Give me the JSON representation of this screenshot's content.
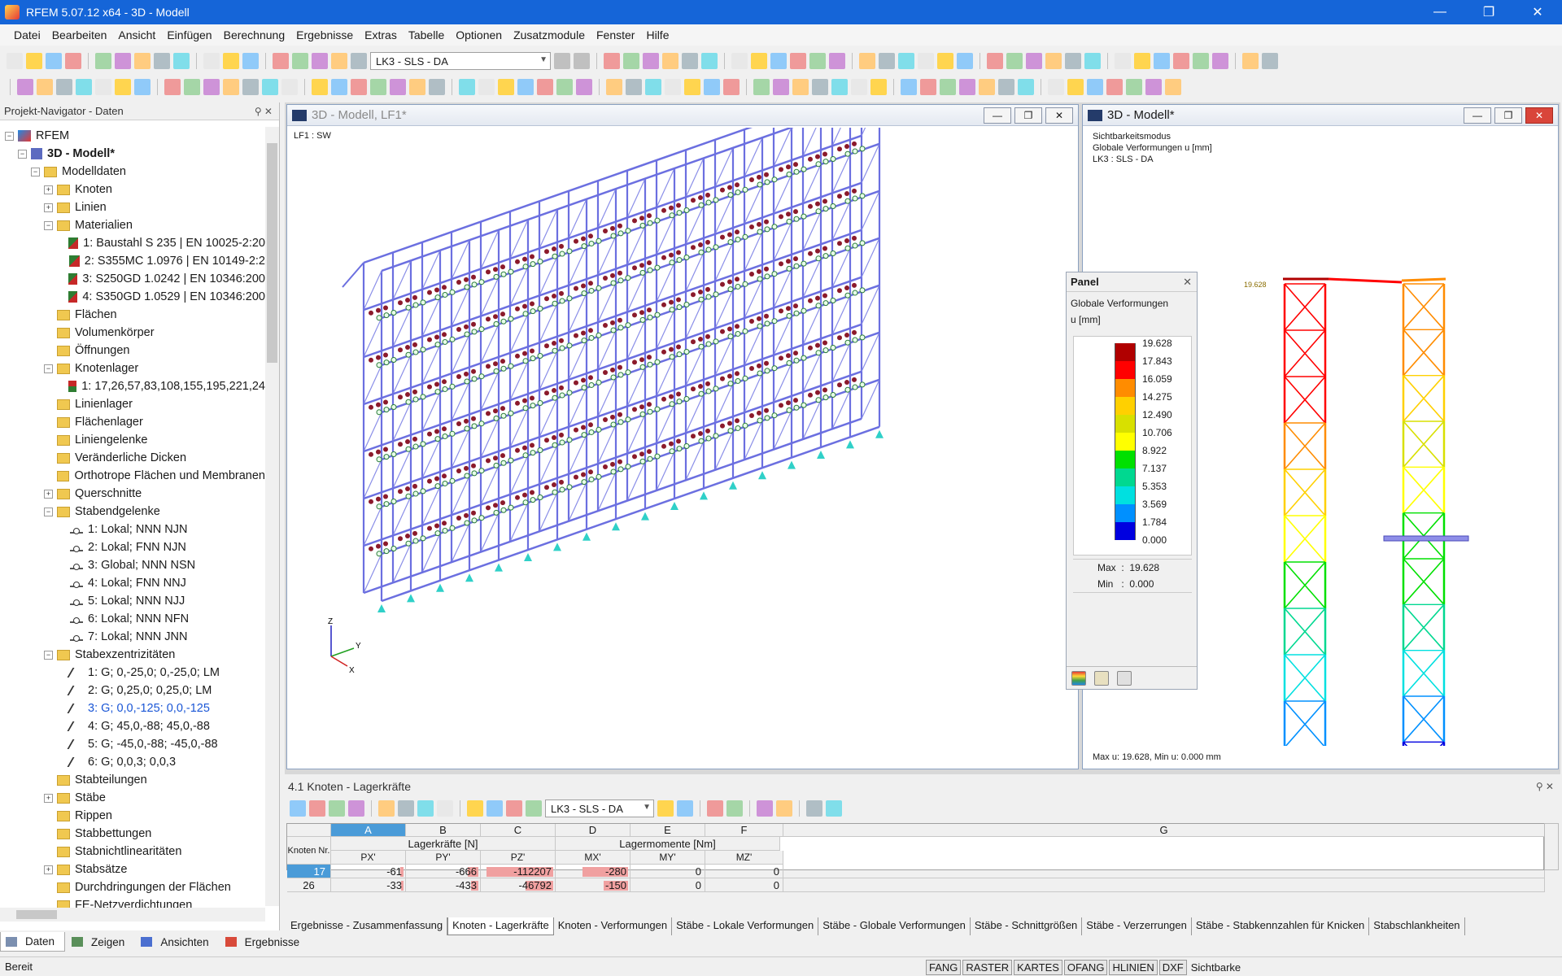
{
  "app": {
    "title": "RFEM 5.07.12 x64 - 3D - Modell",
    "controls": [
      "minimize-icon",
      "maximize-icon",
      "close-icon"
    ]
  },
  "menu": [
    "Datei",
    "Bearbeiten",
    "Ansicht",
    "Einfügen",
    "Berechnung",
    "Ergebnisse",
    "Extras",
    "Tabelle",
    "Optionen",
    "Zusatzmodule",
    "Fenster",
    "Hilfe"
  ],
  "toolbar": {
    "loadcase": "LK3 - SLS - DA"
  },
  "navigator": {
    "title": "Projekt-Navigator - Daten",
    "tree": [
      {
        "label": "RFEM",
        "level": 0,
        "icon": "rfem-icon",
        "exp": "-"
      },
      {
        "label": "3D - Modell*",
        "level": 1,
        "icon": "model-icon",
        "exp": "-",
        "bold": true
      },
      {
        "label": "Modelldaten",
        "level": 2,
        "icon": "folder-icon",
        "exp": "-"
      },
      {
        "label": "Knoten",
        "level": 3,
        "icon": "folder-icon",
        "exp": "+"
      },
      {
        "label": "Linien",
        "level": 3,
        "icon": "folder-icon",
        "exp": "+"
      },
      {
        "label": "Materialien",
        "level": 3,
        "icon": "folder-icon",
        "exp": "-"
      },
      {
        "label": "1: Baustahl S 235 | EN 10025-2:20",
        "level": 4,
        "icon": "material-icon"
      },
      {
        "label": "2: S355MC 1.0976 | EN 10149-2:2",
        "level": 4,
        "icon": "material-icon"
      },
      {
        "label": "3: S250GD 1.0242 | EN 10346:200",
        "level": 4,
        "icon": "material-icon"
      },
      {
        "label": "4: S350GD 1.0529 | EN 10346:200",
        "level": 4,
        "icon": "material-icon"
      },
      {
        "label": "Flächen",
        "level": 3,
        "icon": "folder-icon"
      },
      {
        "label": "Volumenkörper",
        "level": 3,
        "icon": "folder-icon"
      },
      {
        "label": "Öffnungen",
        "level": 3,
        "icon": "folder-icon"
      },
      {
        "label": "Knotenlager",
        "level": 3,
        "icon": "folder-icon",
        "exp": "-"
      },
      {
        "label": "1: 17,26,57,83,108,155,195,221,24",
        "level": 4,
        "icon": "support-icon"
      },
      {
        "label": "Linienlager",
        "level": 3,
        "icon": "folder-icon"
      },
      {
        "label": "Flächenlager",
        "level": 3,
        "icon": "folder-icon"
      },
      {
        "label": "Liniengelenke",
        "level": 3,
        "icon": "folder-icon"
      },
      {
        "label": "Veränderliche Dicken",
        "level": 3,
        "icon": "folder-icon"
      },
      {
        "label": "Orthotrope Flächen und Membranen",
        "level": 3,
        "icon": "folder-icon"
      },
      {
        "label": "Querschnitte",
        "level": 3,
        "icon": "folder-icon",
        "exp": "+"
      },
      {
        "label": "Stabendgelenke",
        "level": 3,
        "icon": "folder-icon",
        "exp": "-"
      },
      {
        "label": "1: Lokal; NNN NJN",
        "level": 4,
        "icon": "hinge-icon"
      },
      {
        "label": "2: Lokal; FNN NJN",
        "level": 4,
        "icon": "hinge-icon"
      },
      {
        "label": "3: Global; NNN NSN",
        "level": 4,
        "icon": "hinge-icon"
      },
      {
        "label": "4: Lokal; FNN NNJ",
        "level": 4,
        "icon": "hinge-icon"
      },
      {
        "label": "5: Lokal; NNN NJJ",
        "level": 4,
        "icon": "hinge-icon"
      },
      {
        "label": "6: Lokal; NNN NFN",
        "level": 4,
        "icon": "hinge-icon"
      },
      {
        "label": "7: Lokal; NNN JNN",
        "level": 4,
        "icon": "hinge-icon"
      },
      {
        "label": "Stabexzentrizitäten",
        "level": 3,
        "icon": "folder-icon",
        "exp": "-"
      },
      {
        "label": "1: G; 0,-25,0; 0,-25,0; LM",
        "level": 4,
        "icon": "eccentricity-icon"
      },
      {
        "label": "2: G; 0,25,0; 0,25,0; LM",
        "level": 4,
        "icon": "eccentricity-icon"
      },
      {
        "label": "3: G; 0,0,-125; 0,0,-125",
        "level": 4,
        "icon": "eccentricity-icon",
        "selected": true
      },
      {
        "label": "4: G; 45,0,-88; 45,0,-88",
        "level": 4,
        "icon": "eccentricity-icon"
      },
      {
        "label": "5: G; -45,0,-88; -45,0,-88",
        "level": 4,
        "icon": "eccentricity-icon"
      },
      {
        "label": "6: G; 0,0,3; 0,0,3",
        "level": 4,
        "icon": "eccentricity-icon"
      },
      {
        "label": "Stabteilungen",
        "level": 3,
        "icon": "folder-icon"
      },
      {
        "label": "Stäbe",
        "level": 3,
        "icon": "folder-icon",
        "exp": "+"
      },
      {
        "label": "Rippen",
        "level": 3,
        "icon": "folder-icon"
      },
      {
        "label": "Stabbettungen",
        "level": 3,
        "icon": "folder-icon"
      },
      {
        "label": "Stabnichtlinearitäten",
        "level": 3,
        "icon": "folder-icon"
      },
      {
        "label": "Stabsätze",
        "level": 3,
        "icon": "folder-icon",
        "exp": "+"
      },
      {
        "label": "Durchdringungen der Flächen",
        "level": 3,
        "icon": "folder-icon"
      },
      {
        "label": "FE-Netzverdichtungen",
        "level": 3,
        "icon": "folder-icon"
      }
    ],
    "tabs": [
      "Daten",
      "Zeigen",
      "Ansichten",
      "Ergebnisse"
    ]
  },
  "view1": {
    "title": "3D - Modell, LF1*",
    "label": "LF1 : SW",
    "axes": {
      "x": "X",
      "y": "Y",
      "z": "Z"
    }
  },
  "view2": {
    "title": "3D - Modell*",
    "info": [
      "Sichtbarkeitsmodus",
      "Globale Verformungen u [mm]",
      "LK3 : SLS - DA"
    ],
    "maxlabel": "19.628",
    "footer": "Max u: 19.628, Min u: 0.000 mm"
  },
  "panel": {
    "title": "Panel",
    "heading": "Globale Verformungen",
    "unit": "u [mm]",
    "values": [
      "19.628",
      "17.843",
      "16.059",
      "14.275",
      "12.490",
      "10.706",
      "8.922",
      "7.137",
      "5.353",
      "3.569",
      "1.784",
      "0.000"
    ],
    "colors": [
      "#b00000",
      "#ff0000",
      "#ff8c00",
      "#ffd000",
      "#d8e000",
      "#ffff00",
      "#00e000",
      "#00d890",
      "#00e0e0",
      "#0090ff",
      "#0000e0",
      "#0000a0"
    ],
    "max_label": "Max",
    "max_value": "19.628",
    "min_label": "Min",
    "min_value": "0.000"
  },
  "table": {
    "title": "4.1 Knoten - Lagerkräfte",
    "loadcase": "LK3 - SLS - DA",
    "columns": [
      "A",
      "B",
      "C",
      "D",
      "E",
      "F",
      "G"
    ],
    "group1": "Lagerkräfte [N]",
    "group2": "Lagermomente [Nm]",
    "rowhead": "Knoten Nr.",
    "sub": [
      "PX'",
      "PY'",
      "PZ'",
      "MX'",
      "MY'",
      "MZ'"
    ],
    "rows": [
      {
        "nr": "17",
        "vals": [
          "-61",
          "-666",
          "-112207",
          "-280",
          "0",
          "0"
        ],
        "bars": [
          0.05,
          0.15,
          0.95,
          0.65,
          0,
          0
        ]
      },
      {
        "nr": "26",
        "vals": [
          "-33",
          "-433",
          "-46792",
          "-150",
          "0",
          "0"
        ],
        "bars": [
          0.03,
          0.1,
          0.4,
          0.35,
          0,
          0
        ]
      }
    ],
    "tabs": [
      "Ergebnisse - Zusammenfassung",
      "Knoten - Lagerkräfte",
      "Knoten - Verformungen",
      "Stäbe - Lokale Verformungen",
      "Stäbe - Globale Verformungen",
      "Stäbe - Schnittgrößen",
      "Stäbe - Verzerrungen",
      "Stäbe - Stabkennzahlen für Knicken",
      "Stabschlankheiten"
    ]
  },
  "status": {
    "text": "Bereit",
    "buttons": [
      "FANG",
      "RASTER",
      "KARTES",
      "OFANG",
      "HLINIEN",
      "DXF"
    ],
    "extra": "Sichtbarke"
  }
}
